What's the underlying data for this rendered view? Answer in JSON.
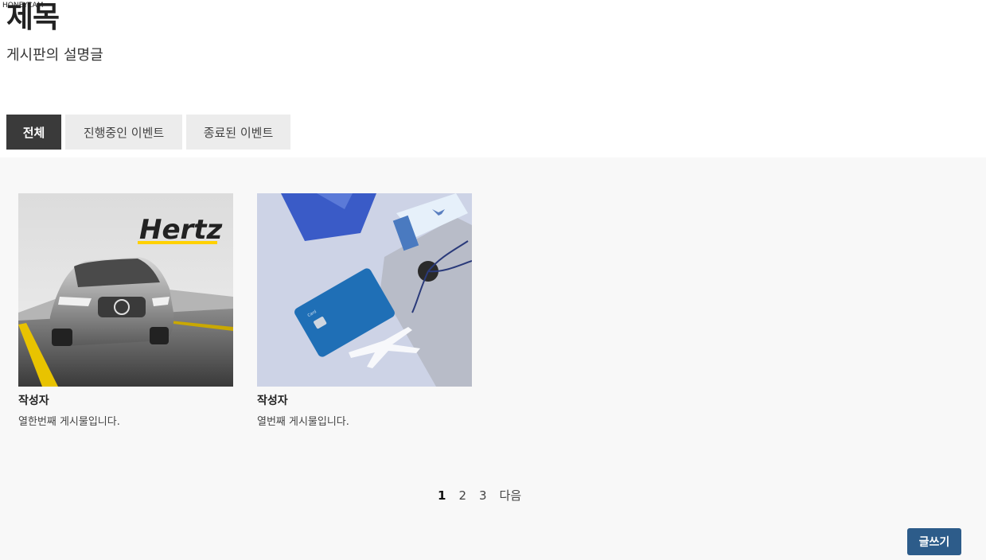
{
  "watermark": "HONEYCAM",
  "header": {
    "title": "제목",
    "description": "게시판의 설명글"
  },
  "tabs": [
    {
      "label": "전체",
      "active": true
    },
    {
      "label": "진행중인 이벤트",
      "active": false
    },
    {
      "label": "종료된 이벤트",
      "active": false
    }
  ],
  "posts": [
    {
      "author": "작성자",
      "excerpt": "열한번째 게시물입니다.",
      "image_brand_text": "Hertz"
    },
    {
      "author": "작성자",
      "excerpt": "열번째 게시물입니다."
    }
  ],
  "pagination": {
    "pages": [
      "1",
      "2",
      "3"
    ],
    "current": "1",
    "next_label": "다음"
  },
  "write_button_label": "글쓰기",
  "colors": {
    "active_tab_bg": "#3a3a3a",
    "tab_bg": "#ececec",
    "content_bg": "#f8f8f8",
    "write_button_bg": "#2d5c8a",
    "hertz_yellow": "#ffd100"
  }
}
